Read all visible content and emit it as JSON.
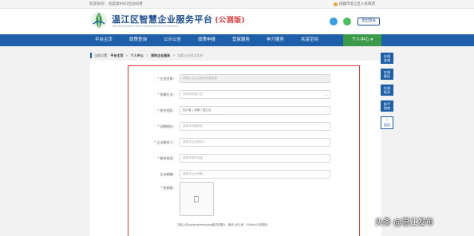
{
  "topbar": {
    "welcome": "欢迎访问！ 您是第9403位访问者",
    "location": "成都市温江区人民政府"
  },
  "header": {
    "title": "温江区智慧企业服务平台",
    "badge": "(公测版)",
    "subtitle": "Wenjiang District Smart Enterprise Service Platform",
    "logout": "退出登录"
  },
  "nav": {
    "items": [
      "平台主页",
      "政策查询",
      "公示公告",
      "政策申报",
      "营家服务",
      "申介服务",
      "共享空间",
      "个人中心 ▾"
    ]
  },
  "breadcrumb": {
    "prefix": "当前位置:",
    "items": [
      "平台主页",
      "个人中心",
      "我的企业服务",
      "查看企业基本信息"
    ]
  },
  "form": {
    "fields": [
      {
        "label": "企业名称:",
        "required": true,
        "placeholder": "请输入企业注册的完整名称",
        "type": "text",
        "disabled": true
      },
      {
        "label": "所属行业:",
        "required": true,
        "placeholder": "请选择所属行业",
        "type": "select"
      },
      {
        "label": "所在地区:",
        "required": true,
        "placeholder": "四川省 / 成都 / 温江区",
        "type": "select"
      },
      {
        "label": "详细地址:",
        "required": true,
        "placeholder": "请填写详细地址",
        "type": "text"
      },
      {
        "label": "企业联系人:",
        "required": true,
        "placeholder": "请填写企业联系人",
        "type": "text"
      },
      {
        "label": "联系电话:",
        "required": true,
        "placeholder": "请填写联系电话",
        "type": "text"
      },
      {
        "label": "企业邮箱:",
        "required": false,
        "placeholder": "请填写企业邮箱",
        "type": "text"
      }
    ],
    "license_label": "* 执照照:",
    "upload_hint": "只能上传jpg/png/bmp/jpeg格式的图片，最多上传1张，500kb以内的图片"
  },
  "float_buttons": [
    "在线\n咨询",
    "在线\n建议",
    "在线\n投诉",
    "新手\n指南",
    "^\n返回"
  ],
  "watermark": "头条 @温江发布"
}
